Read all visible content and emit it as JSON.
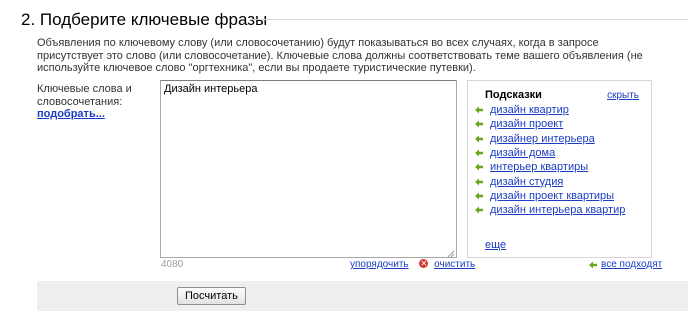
{
  "section": {
    "title": "2. Подберите ключевые фразы",
    "description": "Объявления по ключевому слову (или словосочетанию) будут показываться во всех случаях, когда в запросе присутствует это слово (или словосочетание). Ключевые слова должны соответствовать теме вашего объявления (не используйте ключевое слово \"оргтехника\", если вы продаете туристические путевки)."
  },
  "keywords": {
    "label": "Ключевые слова и словосочетания:",
    "pick_link": "подобрать...",
    "value": "Дизайн интерьера",
    "counter": "4080",
    "sort_link": "упорядочить",
    "clear_link": "очистить"
  },
  "hints": {
    "title": "Подсказки",
    "hide_link": "скрыть",
    "items": [
      "дизайн квартир",
      "дизайн проект",
      "дизайнер интерьера",
      "дизайн дома",
      "интерьер квартиры",
      "дизайн студия",
      "дизайн проект квартиры",
      "дизайн интерьера квартир"
    ],
    "more_link": "еще",
    "all_fit_link": "все подходят"
  },
  "footer": {
    "submit_label": "Посчитать"
  },
  "colors": {
    "link": "#1a3dc1",
    "arrow": "#6aa520",
    "clear": "#d23a2e"
  },
  "icons": {
    "arrow": "green-left-arrow-icon",
    "clear": "red-x-circle-icon",
    "grip": "resize-grip-icon"
  }
}
